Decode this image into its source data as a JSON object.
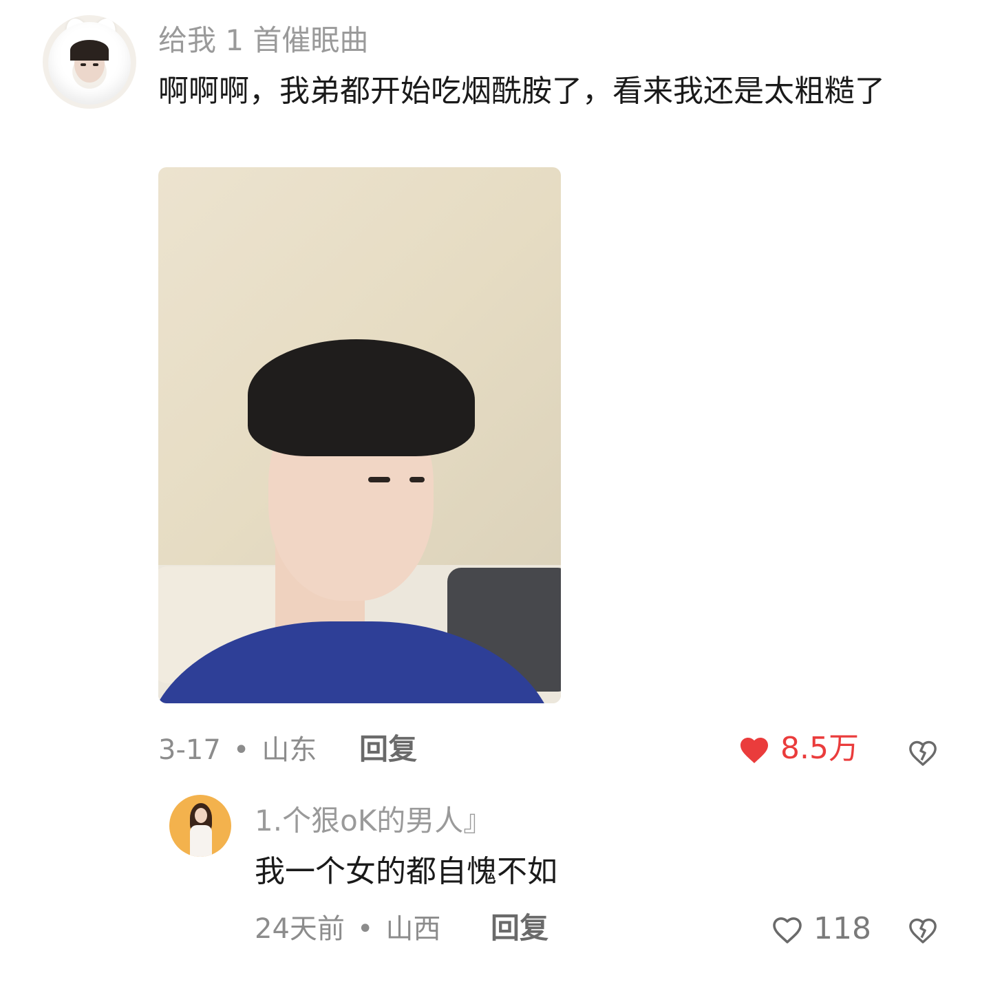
{
  "comment": {
    "username": "给我 1 首催眠曲",
    "text": "啊啊啊，我弟都开始吃烟酰胺了，看来我还是太粗糙了",
    "date": "3-17",
    "location": "山东",
    "separator": "•",
    "reply_label": "回复",
    "likes": "8.5万",
    "liked": true,
    "like_color": "#ea3c3c"
  },
  "reply": {
    "username": "1.个狠oK的男人』",
    "text": "我一个女的都自愧不如",
    "date": "24天前",
    "location": "山西",
    "separator": "•",
    "reply_label": "回复",
    "likes": "118",
    "liked": false
  },
  "icons": {
    "like": "heart-icon",
    "dislike": "broken-heart-icon"
  }
}
